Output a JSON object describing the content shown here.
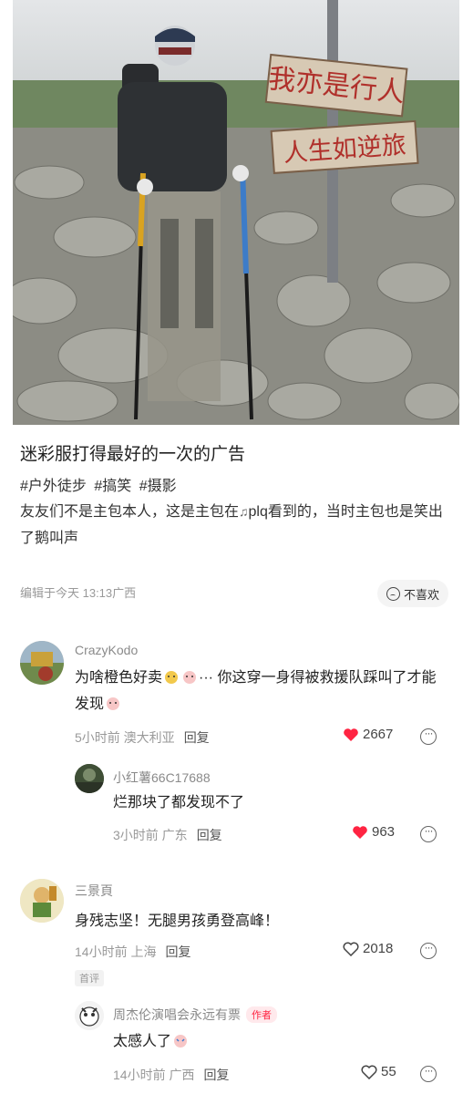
{
  "post": {
    "title": "迷彩服打得最好的一次的广告",
    "tags": [
      "#户外徒步",
      "#搞笑",
      "#摄影"
    ],
    "description_prefix": "友友们不是主包本人，这是主包在",
    "description_source": "plq",
    "description_suffix": "看到的，当时主包也是笑出了鹅叫声",
    "edit_time": "编辑于今天 13:13广西",
    "dislike_label": "不喜欢",
    "photo_sign_top": "我亦是行人",
    "photo_sign_bottom": "人生如逆旅"
  },
  "comments": [
    {
      "name": "CrazyKodo",
      "text_a": "为啥橙色好卖",
      "text_b": "··· 你这穿一身得被救援队踩叫了才能发现",
      "time": "5小时前 澳大利亚",
      "reply_label": "回复",
      "likes": "2667",
      "liked": true,
      "reply": {
        "name": "小红薯66C17688",
        "text": "烂那块了都发现不了",
        "time": "3小时前 广东",
        "reply_label": "回复",
        "likes": "963",
        "liked": true
      }
    },
    {
      "name": "三景頁",
      "text": "身残志坚！无腿男孩勇登高峰！",
      "time": "14小时前 上海",
      "reply_label": "回复",
      "likes": "2018",
      "liked": false,
      "badge": "首评",
      "reply": {
        "name": "周杰伦演唱会永远有票",
        "author_tag": "作者",
        "text": "太感人了",
        "time": "14小时前 广西",
        "reply_label": "回复",
        "likes": "55",
        "liked": false
      }
    }
  ],
  "colors": {
    "like_red": "#ff2442",
    "meta_gray": "#999999",
    "name_gray": "#8a8a8a"
  }
}
